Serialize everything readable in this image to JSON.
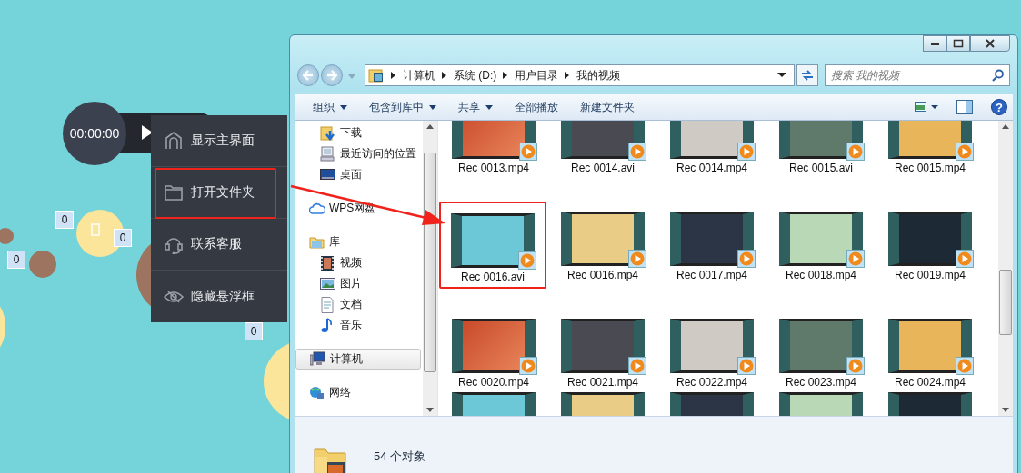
{
  "widget": {
    "timer": "00:00:00",
    "menu": [
      {
        "kind": "home",
        "label": "显示主界面",
        "annotated": false
      },
      {
        "kind": "folder",
        "label": "打开文件夹",
        "annotated": true
      },
      {
        "kind": "headset",
        "label": "联系客服",
        "annotated": false
      },
      {
        "kind": "eye-off",
        "label": "隐藏悬浮框",
        "annotated": false
      }
    ],
    "counters": [
      "0",
      "0",
      "0",
      "0"
    ]
  },
  "explorer": {
    "address": {
      "segments": [
        "计算机",
        "系统 (D:)",
        "用户目录",
        "我的视频"
      ]
    },
    "search": {
      "placeholder": "搜索 我的视频"
    },
    "toolbar": [
      {
        "label": "组织",
        "dropdown": true
      },
      {
        "label": "包含到库中",
        "dropdown": true
      },
      {
        "label": "共享",
        "dropdown": true
      },
      {
        "label": "全部播放",
        "dropdown": false
      },
      {
        "label": "新建文件夹",
        "dropdown": false
      }
    ],
    "nav": [
      {
        "children": [
          {
            "kind": "download",
            "label": "下载",
            "selected": false
          },
          {
            "kind": "recent",
            "label": "最近访问的位置",
            "selected": false
          },
          {
            "kind": "desktop",
            "label": "桌面",
            "selected": false
          }
        ]
      },
      {
        "kind": "cloud",
        "label": "WPS网盘",
        "selected": false
      },
      {
        "kind": "library",
        "label": "库",
        "selected": false,
        "children": [
          {
            "kind": "video",
            "label": "视频",
            "selected": false
          },
          {
            "kind": "picture",
            "label": "图片",
            "selected": false
          },
          {
            "kind": "document",
            "label": "文档",
            "selected": false
          },
          {
            "kind": "music",
            "label": "音乐",
            "selected": false
          }
        ]
      },
      {
        "kind": "computer",
        "label": "计算机",
        "selected": true
      },
      {
        "kind": "network",
        "label": "网络",
        "selected": false
      }
    ],
    "files": [
      {
        "name": "Rec 0013.mp4",
        "annotated": false
      },
      {
        "name": "Rec 0014.avi",
        "annotated": false
      },
      {
        "name": "Rec 0014.mp4",
        "annotated": false
      },
      {
        "name": "Rec 0015.avi",
        "annotated": false
      },
      {
        "name": "Rec 0015.mp4",
        "annotated": false
      },
      {
        "name": "Rec 0016.avi",
        "annotated": true
      },
      {
        "name": "Rec 0016.mp4",
        "annotated": false
      },
      {
        "name": "Rec 0017.mp4",
        "annotated": false
      },
      {
        "name": "Rec 0018.mp4",
        "annotated": false
      },
      {
        "name": "Rec 0019.mp4",
        "annotated": false
      },
      {
        "name": "Rec 0020.mp4",
        "annotated": false
      },
      {
        "name": "Rec 0021.mp4",
        "annotated": false
      },
      {
        "name": "Rec 0022.mp4",
        "annotated": false
      },
      {
        "name": "Rec 0023.mp4",
        "annotated": false
      },
      {
        "name": "Rec 0024.mp4",
        "annotated": false
      },
      {
        "annotated": false
      },
      {
        "annotated": false
      },
      {
        "annotated": false
      },
      {
        "annotated": false
      },
      {
        "annotated": false
      }
    ],
    "help_glyph": "?",
    "status_bar": {
      "text": "54 个对象"
    }
  },
  "annotation": {
    "arrow": true
  }
}
